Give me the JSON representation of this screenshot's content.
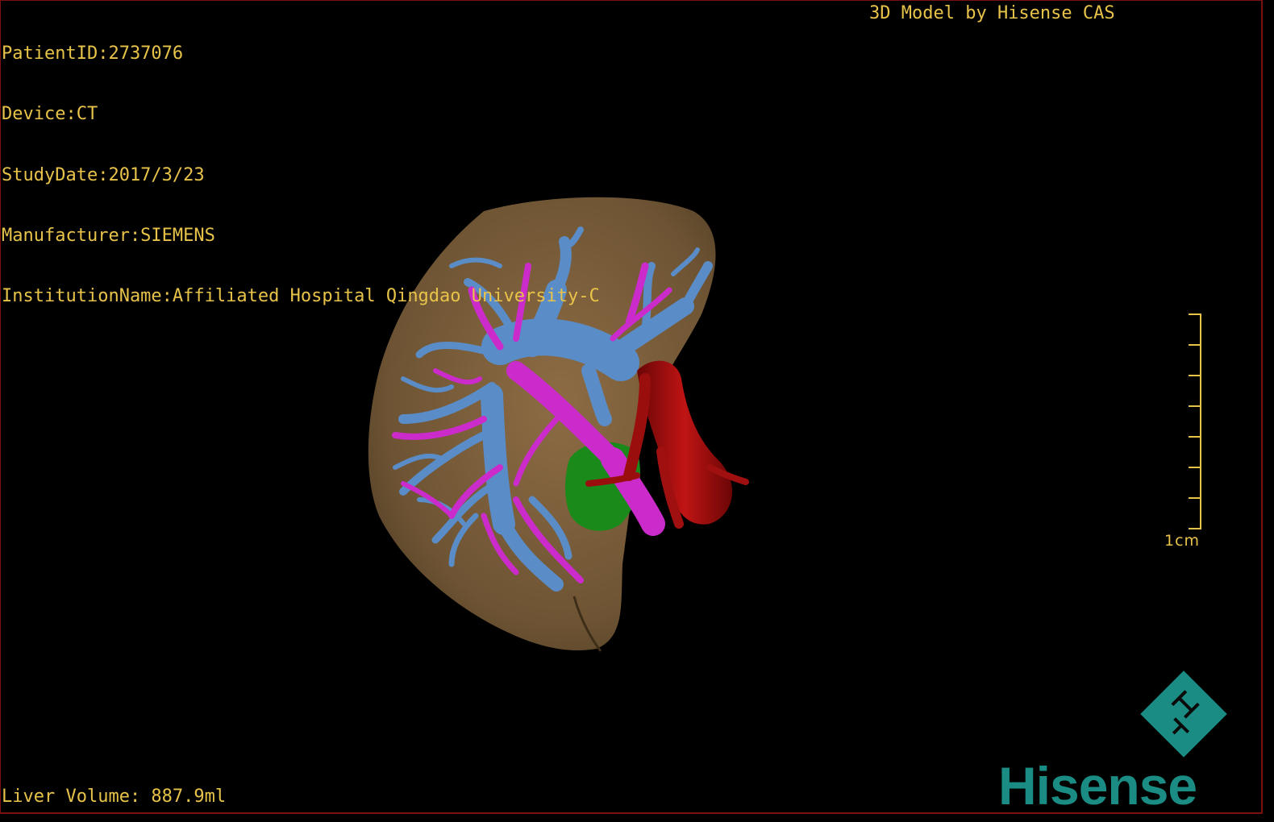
{
  "header": {
    "patient_id": "PatientID:2737076",
    "device": "Device:CT",
    "study_date": "StudyDate:2017/3/23",
    "manufacturer": "Manufacturer:SIEMENS",
    "institution": "InstitutionName:Affiliated Hospital Qingdao University-C",
    "title": "3D Model by Hisense CAS"
  },
  "footer": {
    "liver_volume": "Liver Volume: 887.9ml"
  },
  "scale_bar": {
    "label": "1cm",
    "ticks": 8
  },
  "logo": {
    "brand": "Hisense"
  },
  "colors": {
    "overlay_text": "#e8c34a",
    "liver": "#7a5e3a",
    "portal_vein": "#5a8cc8",
    "hepatic_artery": "#cc2bcc",
    "vena_cava": "#b01010",
    "gallbladder": "#1a8a1a",
    "brand": "#1a8c84"
  }
}
